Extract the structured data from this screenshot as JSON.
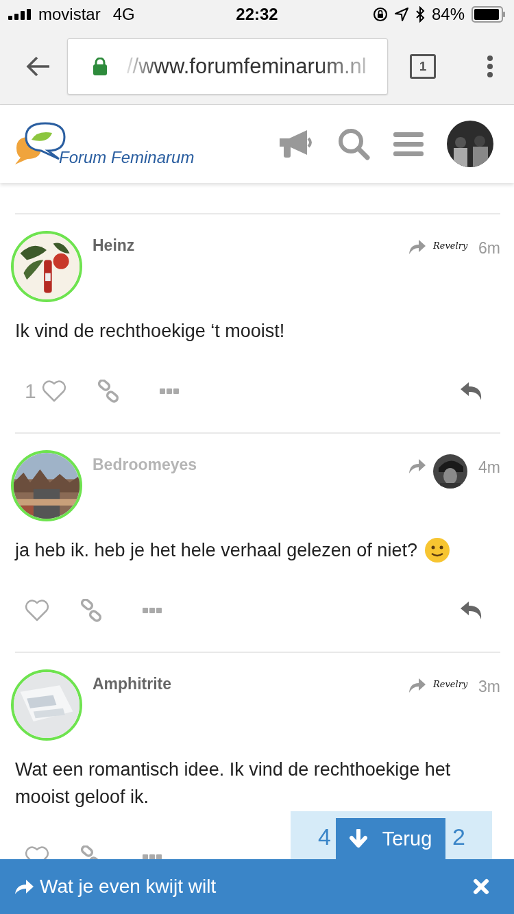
{
  "status_bar": {
    "carrier": "movistar",
    "network": "4G",
    "time": "22:32",
    "battery": "84%"
  },
  "browser": {
    "url": "//www.forumfeminarum.nl",
    "tab_count": "1"
  },
  "site_header": {
    "title": "Forum Feminarum"
  },
  "posts": [
    {
      "author": "Heinz",
      "dimmed": false,
      "time": "6m",
      "badge": {
        "kind": "logo",
        "text": "Revelry"
      },
      "body": "Ik vind de rechthoekige ‘t mooist!",
      "smiley": false,
      "likes": "1",
      "reply_button": true
    },
    {
      "author": "Bedroomeyes",
      "dimmed": true,
      "time": "4m",
      "body": "ja heb ik. heb je het hele verhaal gelezen of niet?",
      "smiley": true,
      "reply_button": true
    },
    {
      "author": "Amphitrite",
      "dimmed": false,
      "time": "3m",
      "badge": {
        "kind": "logo",
        "text": "Revelry"
      },
      "body": "Wat een romantisch idee. Ik vind de rechthoekige het mooist geloof ik.",
      "smiley": false,
      "reply_button": false
    }
  ],
  "progress": {
    "current": "4",
    "total": "2",
    "back_button": "Terug"
  },
  "banner": {
    "title": "Wat je even kwijt wilt"
  }
}
